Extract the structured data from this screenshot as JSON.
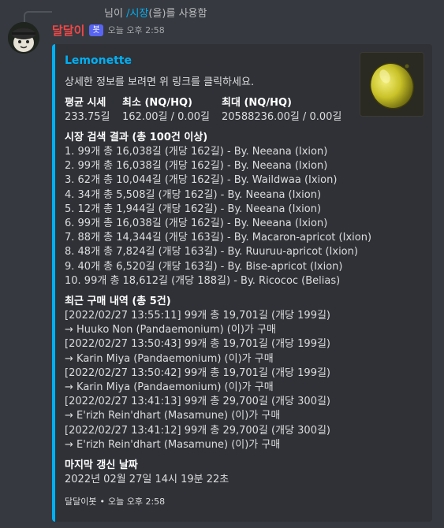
{
  "reply": {
    "prefix": "님이 ",
    "command": "/시장",
    "suffix": "(을)를 사용함"
  },
  "message": {
    "username": "달달이",
    "bot_tag": "봇",
    "timestamp": "오늘 오후 2:58"
  },
  "embed": {
    "accent_color": "#00b0f4",
    "title": "Lemonette",
    "description": "상세한 정보를 보려면 위 링크를 클릭하세요.",
    "thumbnail_icon": "lemon-icon",
    "fields": [
      {
        "name": "평균 시세",
        "value": "233.75길"
      },
      {
        "name": "최소 (NQ/HQ)",
        "value": "162.00길 / 0.00길"
      },
      {
        "name": "최대 (NQ/HQ)",
        "value": "20588236.00길 / 0.00길"
      }
    ],
    "market": {
      "name": "시장 검색 결과 (총 100건 이상)",
      "lines": [
        "1. 99개 총 16,038길 (개당 162길) - By. Neeana (Ixion)",
        "2. 99개 총 16,038길 (개당 162길) - By. Neeana (Ixion)",
        "3. 62개 총 10,044길 (개당 162길) - By. Waildwaa (Ixion)",
        "4. 34개 총 5,508길 (개당 162길) - By. Neeana (Ixion)",
        "5. 12개 총 1,944길 (개당 162길) - By. Neeana (Ixion)",
        "6. 99개 총 16,038길 (개당 162길) - By. Neeana (Ixion)",
        "7. 88개 총 14,344길 (개당 163길) - By. Macaron-apricot (Ixion)",
        "8. 48개 총 7,824길 (개당 163길) - By. Ruuruu-apricot (Ixion)",
        "9. 40개 총 6,520길 (개당 163길) - By. Bise-apricot (Ixion)",
        "10. 99개 총 18,612길 (개당 188길) - By. Ricococ (Belias)"
      ]
    },
    "history": {
      "name": "최근 구매 내역 (총 5건)",
      "lines": [
        "[2022/02/27 13:55:11] 99개 총 19,701길 (개당 199길)",
        "→ Huuko Non (Pandaemonium) (이)가 구매",
        "[2022/02/27 13:50:43] 99개 총 19,701길 (개당 199길)",
        "→ Karin Miya (Pandaemonium) (이)가 구매",
        "[2022/02/27 13:50:42] 99개 총 19,701길 (개당 199길)",
        "→ Karin Miya (Pandaemonium) (이)가 구매",
        "[2022/02/27 13:41:13] 99개 총 29,700길 (개당 300길)",
        "→ E'rizh Rein'dhart (Masamune) (이)가 구매",
        "[2022/02/27 13:41:12] 99개 총 29,700길 (개당 300길)",
        "→ E'rizh Rein'dhart (Masamune) (이)가 구매"
      ]
    },
    "updated": {
      "name": "마지막 갱신 날짜",
      "value": "2022년 02월 27일 14시 19분 22초"
    },
    "footer": {
      "text": "달달이봇",
      "separator": "•",
      "timestamp": "오늘 오후 2:58"
    }
  }
}
